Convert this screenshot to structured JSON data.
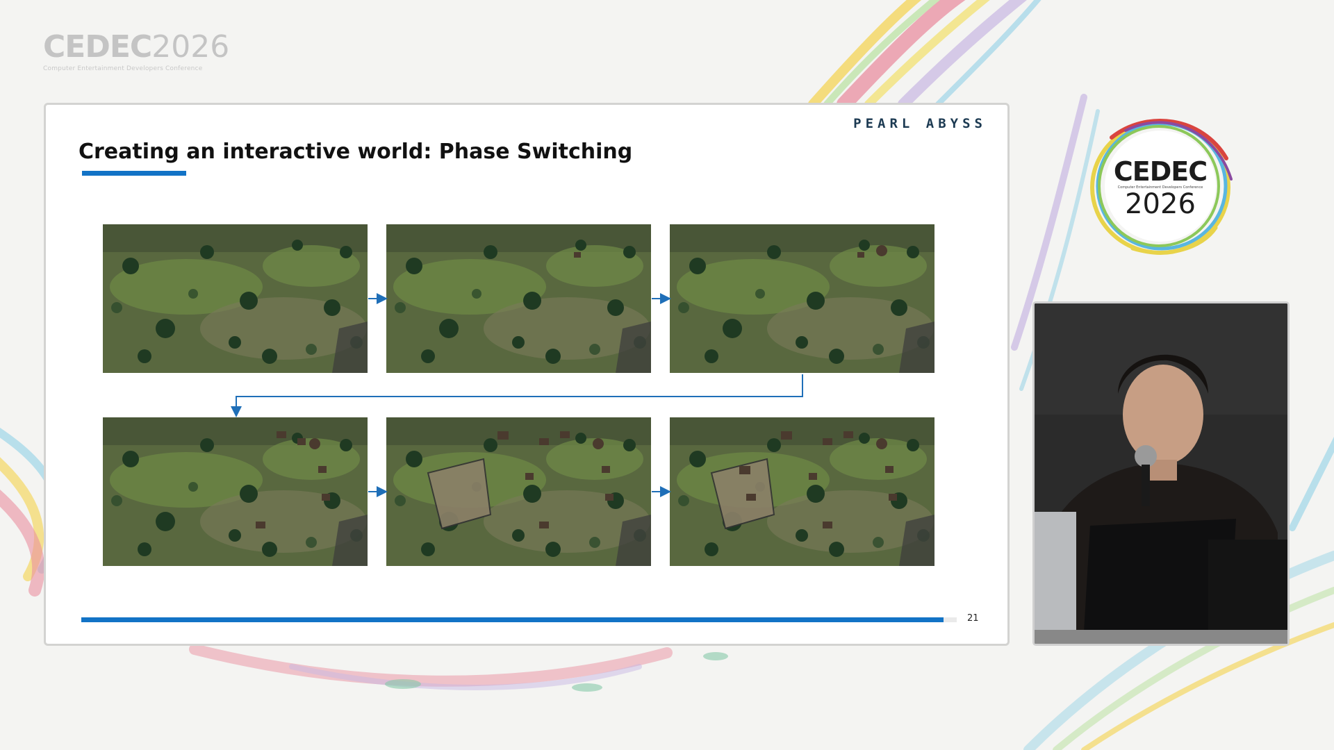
{
  "event": {
    "brand": "CEDEC",
    "year": "2026",
    "subtitle": "Computer Entertainment Developers Conference"
  },
  "slide": {
    "company": "PEARL ABYSS",
    "title": "Creating an interactive world: Phase Switching",
    "page_number": "21",
    "progress_fraction": 0.985,
    "accent_color": "#1273c6",
    "thumbnails": [
      {
        "row": 1,
        "col": 1,
        "phase": 1
      },
      {
        "row": 1,
        "col": 2,
        "phase": 2
      },
      {
        "row": 1,
        "col": 3,
        "phase": 3
      },
      {
        "row": 2,
        "col": 1,
        "phase": 4
      },
      {
        "row": 2,
        "col": 2,
        "phase": 5
      },
      {
        "row": 2,
        "col": 3,
        "phase": 6
      }
    ]
  },
  "icons": {
    "arrow": "arrow-right-icon",
    "logo": "cedec-logo-icon"
  }
}
